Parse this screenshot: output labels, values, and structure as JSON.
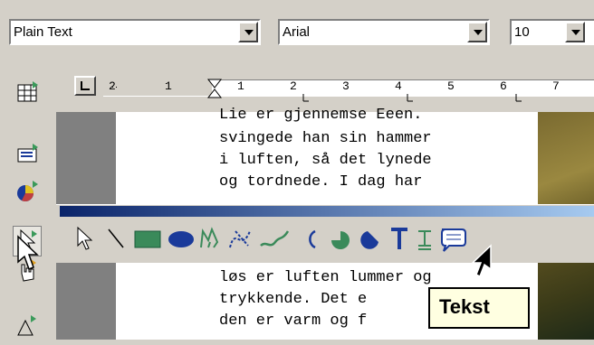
{
  "toolbar": {
    "style_value": "Plain Text",
    "font_value": "Arial",
    "size_value": "10"
  },
  "ruler": {
    "tick_labels": [
      "2",
      "1",
      "1",
      "2",
      "3",
      "4",
      "5",
      "6",
      "7"
    ]
  },
  "document": {
    "lines": [
      "Lie er gjennemse Eeen.",
      "svingede han sin hammer",
      "i luften, så det lynede",
      "og tordnede. I dag har",
      "løs er luften lummer og",
      "trykkende. Det e",
      "den er varm og f"
    ]
  },
  "draw_toolbar": {
    "tools": [
      "select",
      "line",
      "rectangle",
      "ellipse",
      "polygon",
      "curve",
      "freeform",
      "arc",
      "pie",
      "ellipse-segment",
      "text",
      "vertical-text",
      "callout"
    ]
  },
  "tooltip": {
    "text": "Tekst"
  },
  "colors": {
    "title_bar_start": "#0a246a",
    "title_bar_end": "#a6caf0",
    "tooltip_bg": "#ffffe1",
    "icon_green": "#3a9a5a",
    "icon_blue": "#1a3a9a"
  }
}
